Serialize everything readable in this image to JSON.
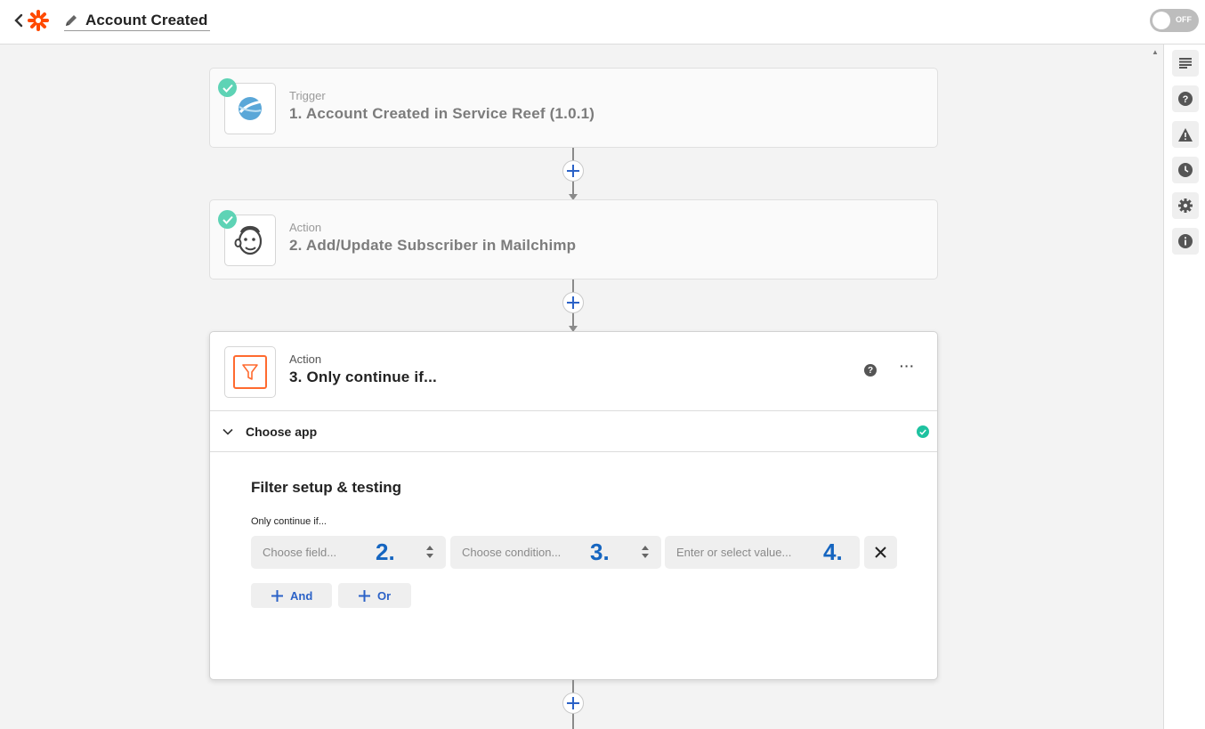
{
  "header": {
    "title": "Account Created",
    "toggle_label": "OFF",
    "brand_color": "#ff4a00"
  },
  "steps": [
    {
      "kind": "Trigger",
      "name": "1. Account Created in Service Reef (1.0.1)",
      "app_icon": "service-reef-icon",
      "status": "complete"
    },
    {
      "kind": "Action",
      "name": "2. Add/Update Subscriber in Mailchimp",
      "app_icon": "mailchimp-icon",
      "status": "complete"
    },
    {
      "kind": "Action",
      "name": "3. Only continue if...",
      "app_icon": "filter-icon",
      "status": "active"
    }
  ],
  "active_step": {
    "help_glyph": "?",
    "more_label": "···",
    "section_label": "Choose app",
    "filter_title": "Filter setup & testing",
    "filter_subtitle": "Only continue if...",
    "field": {
      "placeholder": "Choose field...",
      "annotation": "2."
    },
    "condition": {
      "placeholder": "Choose condition...",
      "annotation": "3."
    },
    "value": {
      "placeholder": "Enter or select value...",
      "annotation": "4."
    },
    "and_label": "And",
    "or_label": "Or"
  },
  "sidebar": {
    "icons": [
      "outline-icon",
      "help-icon",
      "warning-icon",
      "history-icon",
      "settings-icon",
      "info-icon"
    ]
  },
  "colors": {
    "check_green": "#5ed3b5",
    "accent_blue": "#2b62c7",
    "annotation_blue": "#1565c0",
    "filter_orange": "#ff6a2f"
  }
}
